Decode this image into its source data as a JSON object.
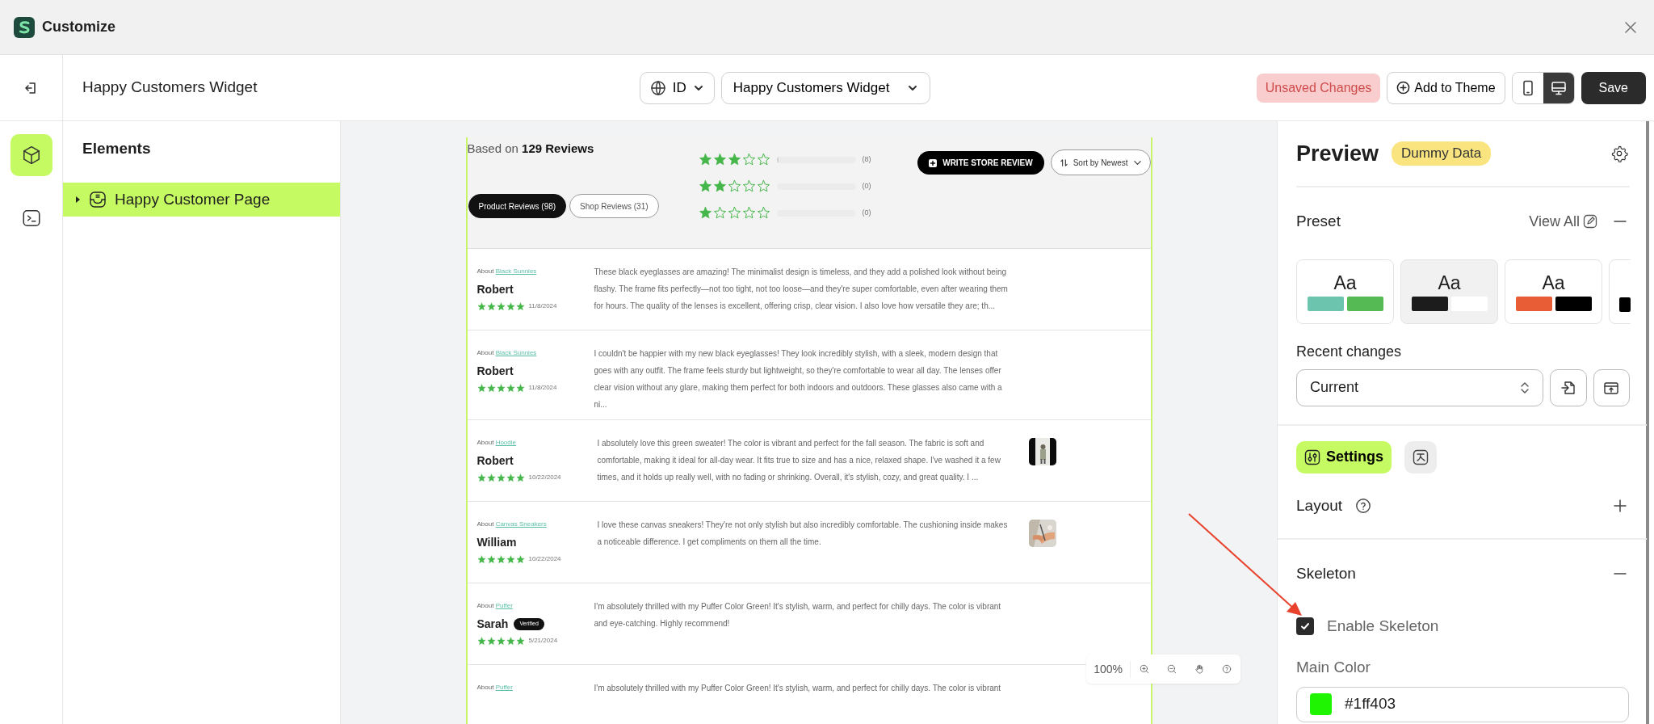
{
  "window": {
    "title": "Customize"
  },
  "toolbar": {
    "page_title": "Happy Customers Widget",
    "language": "ID",
    "widget": "Happy Customers Widget",
    "status_badge": "Unsaved Changes",
    "add_button": "Add to Theme",
    "devices": [
      {
        "kind": "mobile",
        "selected": false
      },
      {
        "kind": "desktop",
        "selected": true
      }
    ],
    "save_button": "Save"
  },
  "rail": [
    {
      "kind": "elements",
      "selected": true
    },
    {
      "kind": "code",
      "selected": false
    }
  ],
  "elements_panel": {
    "title": "Elements",
    "items": [
      {
        "label": "Happy Customer Page",
        "selected": true,
        "expanded": false
      }
    ]
  },
  "preview": {
    "summary": "Based on **129 Reviews**",
    "rating_rows": [
      {
        "stars": 3,
        "level": 0.03,
        "count": "(8)"
      },
      {
        "stars": 2,
        "level": 0,
        "count": "(0)"
      },
      {
        "stars": 1,
        "level": 0,
        "count": "(0)"
      }
    ],
    "tabs": [
      {
        "label": "Product Reviews (98)",
        "selected": true
      },
      {
        "label": "Shop Reviews (31)",
        "selected": false
      }
    ],
    "write_button": "WRITE STORE REVIEW",
    "sort": "Sort by Newest",
    "reviews": [
      {
        "about": "About",
        "product": "Black Sunnies",
        "author": "Robert",
        "verified": false,
        "stars": 5,
        "date": "11/8/2024",
        "text": "These black eyeglasses are amazing! The minimalist design is timeless, and they add a polished look without being flashy. The frame fits perfectly—not too tight, not too loose—and they're super comfortable, even after wearing them for hours. The quality of the lenses is excellent, offering crisp, clear vision. I also love how versatile they are; th..."
      },
      {
        "about": "About",
        "product": "Black Sunnies",
        "author": "Robert",
        "verified": false,
        "stars": 5,
        "date": "11/8/2024",
        "text": "I couldn't be happier with my new black eyeglasses! They look incredibly stylish, with a sleek, modern design that goes with any outfit. The frame feels sturdy but lightweight, so they're comfortable to wear all day. The lenses offer clear vision without any glare, making them perfect for both indoors and outdoors. These glasses also came with a ni..."
      },
      {
        "about": "About",
        "product": "Hoodie",
        "author": "Robert",
        "verified": false,
        "stars": 5,
        "date": "10/22/2024",
        "text": "I absolutely love this green sweater! The color is vibrant and perfect for the fall season. The fabric is soft and comfortable, making it ideal for all-day wear. It fits true to size and has a nice, relaxed shape. I've washed it a few times, and it holds up really well, with no fading or shrinking. Overall, it's stylish, cozy, and great quality. I ..."
      },
      {
        "about": "About",
        "product": "Canvas Sneakers",
        "author": "William",
        "verified": false,
        "stars": 5,
        "date": "10/22/2024",
        "text": "I love these canvas sneakers! They're not only stylish but also incredibly comfortable. The cushioning inside makes a noticeable difference. I get compliments on them all the time."
      },
      {
        "about": "About",
        "product": "Puffer",
        "author": "Sarah",
        "verified": true,
        "verified_label": "Verified",
        "stars": 5,
        "date": "5/21/2024",
        "text": "I'm absolutely thrilled with my Puffer Color Green! It's stylish, warm, and perfect for chilly days. The color is vibrant and eye-catching. Highly recommend!"
      },
      {
        "about": "About",
        "product": "Puffer",
        "text": "I'm absolutely thrilled with my Puffer Color Green! It's stylish, warm, and perfect for chilly days. The color is vibrant"
      }
    ],
    "zoom_level": "100%"
  },
  "right_panel": {
    "title": "Preview",
    "badge": "Dummy Data",
    "preset": {
      "title": "Preset",
      "view_all": "View All",
      "expanded": true,
      "cards": [
        {
          "sample": "Aa",
          "selected": false,
          "swatches": [
            {
              "color": "#6cc3ae"
            },
            {
              "color": "#55b954"
            }
          ]
        },
        {
          "sample": "Aa",
          "selected": true,
          "swatches": [
            {
              "color": "#1c1c1c"
            },
            {
              "color": "#ffffff"
            }
          ]
        },
        {
          "sample": "Aa",
          "selected": false,
          "swatches": [
            {
              "color": "#e85d35"
            },
            {
              "color": "#000000"
            }
          ]
        },
        {
          "selected": false,
          "swatches": [
            {
              "color": "#000000"
            }
          ]
        }
      ]
    },
    "recent": {
      "label": "Recent changes",
      "value": "Current"
    },
    "tabs": [
      {
        "kind": "settings",
        "label": "Settings",
        "selected": true
      },
      {
        "kind": "translate",
        "selected": false
      }
    ],
    "layout": {
      "title": "Layout",
      "expanded": false
    },
    "skeleton": {
      "title": "Skeleton",
      "expanded": true,
      "enable": {
        "label": "Enable Skeleton",
        "checked": true
      },
      "main_color": {
        "label": "Main Color",
        "value": "#1ff403",
        "color": "#1ff403"
      }
    }
  },
  "annotation": {
    "kind": "arrow"
  }
}
